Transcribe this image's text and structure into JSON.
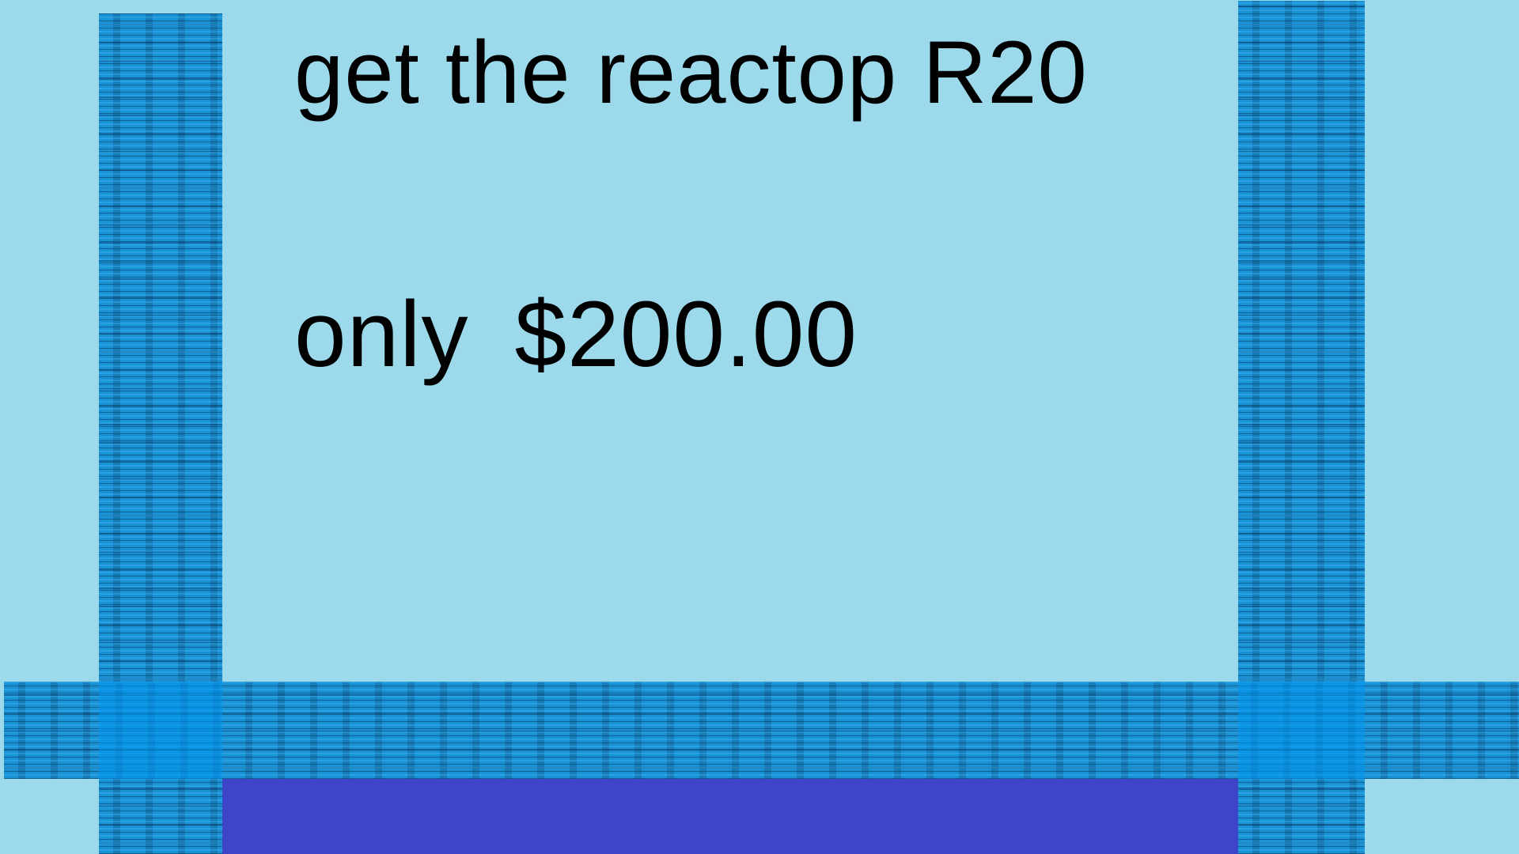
{
  "ad": {
    "headline": "get the reactop R20",
    "price_prefix": "only",
    "price": "$200.00"
  },
  "colors": {
    "background": "#9cd9ea",
    "bar_blue": "#1a92d6",
    "bottom_panel": "#3f45c9",
    "text": "#000000"
  }
}
